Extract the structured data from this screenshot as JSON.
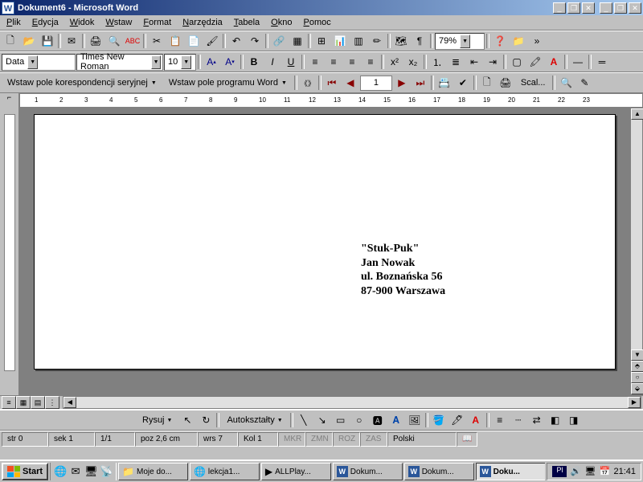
{
  "title": "Dokument6 - Microsoft Word",
  "menus": [
    "Plik",
    "Edycja",
    "Widok",
    "Wstaw",
    "Format",
    "Narzędzia",
    "Tabela",
    "Okno",
    "Pomoc"
  ],
  "zoom": "79%",
  "style_field": "Data",
  "font_field": "Times New Roman",
  "size_field": "10",
  "merge_btn1": "Wstaw pole korespondencji seryjnej",
  "merge_btn2": "Wstaw pole programu Word",
  "merge_record": "1",
  "merge_scal": "Scal...",
  "doc": {
    "line1": "\"Stuk-Puk\"",
    "line2": "Jan Nowak",
    "line3": "ul. Boznańska 56",
    "line4": "87-900 Warszawa"
  },
  "drawbar": {
    "rysuj": "Rysuj",
    "autoksztalty": "Autokształty"
  },
  "status": {
    "str": "str  0",
    "sek": "sek  1",
    "pages": "1/1",
    "poz": "poz  2,6 cm",
    "wrs": "wrs  7",
    "kol": "Kol   1",
    "mkr": "MKR",
    "zmn": "ZMN",
    "roz": "ROZ",
    "zas": "ZAS",
    "lang": "Polski"
  },
  "ruler_nums": [
    1,
    2,
    3,
    4,
    5,
    6,
    7,
    8,
    9,
    10,
    11,
    12,
    13,
    14,
    15,
    16,
    17,
    18,
    19,
    20,
    21,
    22,
    23
  ],
  "taskbar": {
    "start": "Start",
    "tasks": [
      {
        "label": "Moje do...",
        "icon": "📁"
      },
      {
        "label": "lekcja1...",
        "icon": "🌐"
      },
      {
        "label": "ALLPlay...",
        "icon": "▶"
      },
      {
        "label": "Dokum...",
        "icon": "W"
      },
      {
        "label": "Dokum...",
        "icon": "W"
      },
      {
        "label": "Doku...",
        "icon": "W",
        "active": true
      }
    ],
    "lang": "Pl",
    "time": "21:41"
  }
}
